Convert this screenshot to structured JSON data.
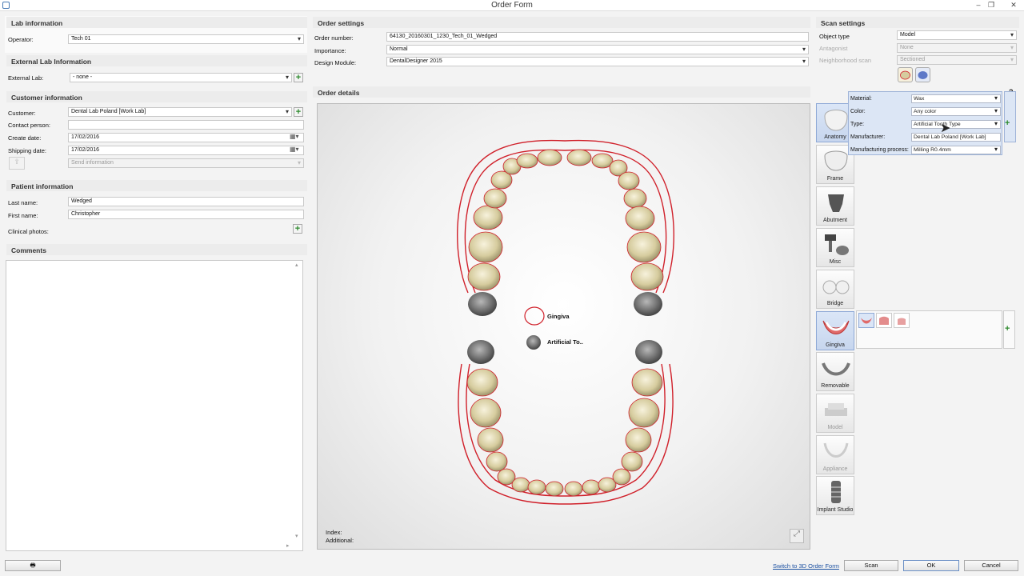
{
  "window": {
    "title": "Order Form",
    "controls": [
      "–",
      "❐",
      "✕"
    ]
  },
  "lab_information": {
    "header": "Lab information",
    "operator_label": "Operator:",
    "operator_value": "Tech 01"
  },
  "external_lab_information": {
    "header": "External Lab Information",
    "external_lab_label": "External Lab:",
    "external_lab_value": "- none -"
  },
  "customer_information": {
    "header": "Customer information",
    "customer_label": "Customer:",
    "customer_value": "Dental Lab Poland [Work Lab]",
    "contact_label": "Contact person:",
    "contact_value": "",
    "create_date_label": "Create date:",
    "create_date_value": "17/02/2016",
    "shipping_date_label": "Shipping date:",
    "shipping_date_value": "17/02/2016",
    "send_information_value": "Send information"
  },
  "patient_information": {
    "header": "Patient information",
    "last_name_label": "Last name:",
    "last_name_value": "Wedged",
    "first_name_label": "First name:",
    "first_name_value": "Christopher",
    "clinical_photos_label": "Clinical photos:"
  },
  "comments": {
    "header": "Comments",
    "value": ""
  },
  "order_settings": {
    "header": "Order settings",
    "order_number_label": "Order number:",
    "order_number_value": "64130_20160301_1230_Tech_01_Wedged",
    "importance_label": "Importance:",
    "importance_value": "Normal",
    "design_module_label": "Design Module:",
    "design_module_value": "DentalDesigner 2015"
  },
  "order_details": {
    "header": "Order details",
    "legend": [
      {
        "label": "Gingiva",
        "icon": "gingiva-outline-icon"
      },
      {
        "label": "Artificial To..",
        "icon": "artificial-tooth-icon"
      }
    ],
    "index_label": "Index:",
    "additional_label": "Additional:"
  },
  "scan_settings": {
    "header": "Scan settings",
    "object_type_label": "Object type",
    "object_type_value": "Model",
    "antagonist_label": "Antagonist",
    "antagonist_value": "None",
    "neighborhood_label": "Neighborhood scan",
    "neighborhood_value": "Sectioned"
  },
  "material_panel": {
    "material_label": "Material:",
    "material_value": "Wax",
    "color_label": "Color:",
    "color_value": "Any color",
    "type_label": "Type:",
    "type_value": "Artificial Tooth Type",
    "manufacturer_label": "Manufacturer:",
    "manufacturer_value": "Dental Lab Poland [Work Lab]",
    "process_label": "Manufacturing process:",
    "process_value": "Milling R0.4mm",
    "help": "?"
  },
  "tools": [
    {
      "label": "Anatomy",
      "icon": "anatomy-icon",
      "active": true
    },
    {
      "label": "Frame",
      "icon": "frame-icon"
    },
    {
      "label": "Abutment",
      "icon": "abutment-icon"
    },
    {
      "label": "Misc",
      "icon": "misc-icon"
    },
    {
      "label": "Bridge",
      "icon": "bridge-icon"
    },
    {
      "label": "Gingiva",
      "icon": "gingiva-icon",
      "active": true
    },
    {
      "label": "Removable",
      "icon": "removable-icon"
    },
    {
      "label": "Model",
      "icon": "model-icon",
      "disabled": true
    },
    {
      "label": "Appliance",
      "icon": "appliance-icon",
      "disabled": true
    },
    {
      "label": "Implant Studio",
      "icon": "implant-studio-icon"
    }
  ],
  "footer": {
    "switch_link": "Switch to 3D Order Form",
    "scan": "Scan",
    "ok": "OK",
    "cancel": "Cancel"
  },
  "colors": {
    "gingiva_outline": "#d0202a",
    "tooth": "#d8cfa4",
    "artificial_tooth": "#6d6d6d",
    "active_tool": "#c7d6ee"
  }
}
